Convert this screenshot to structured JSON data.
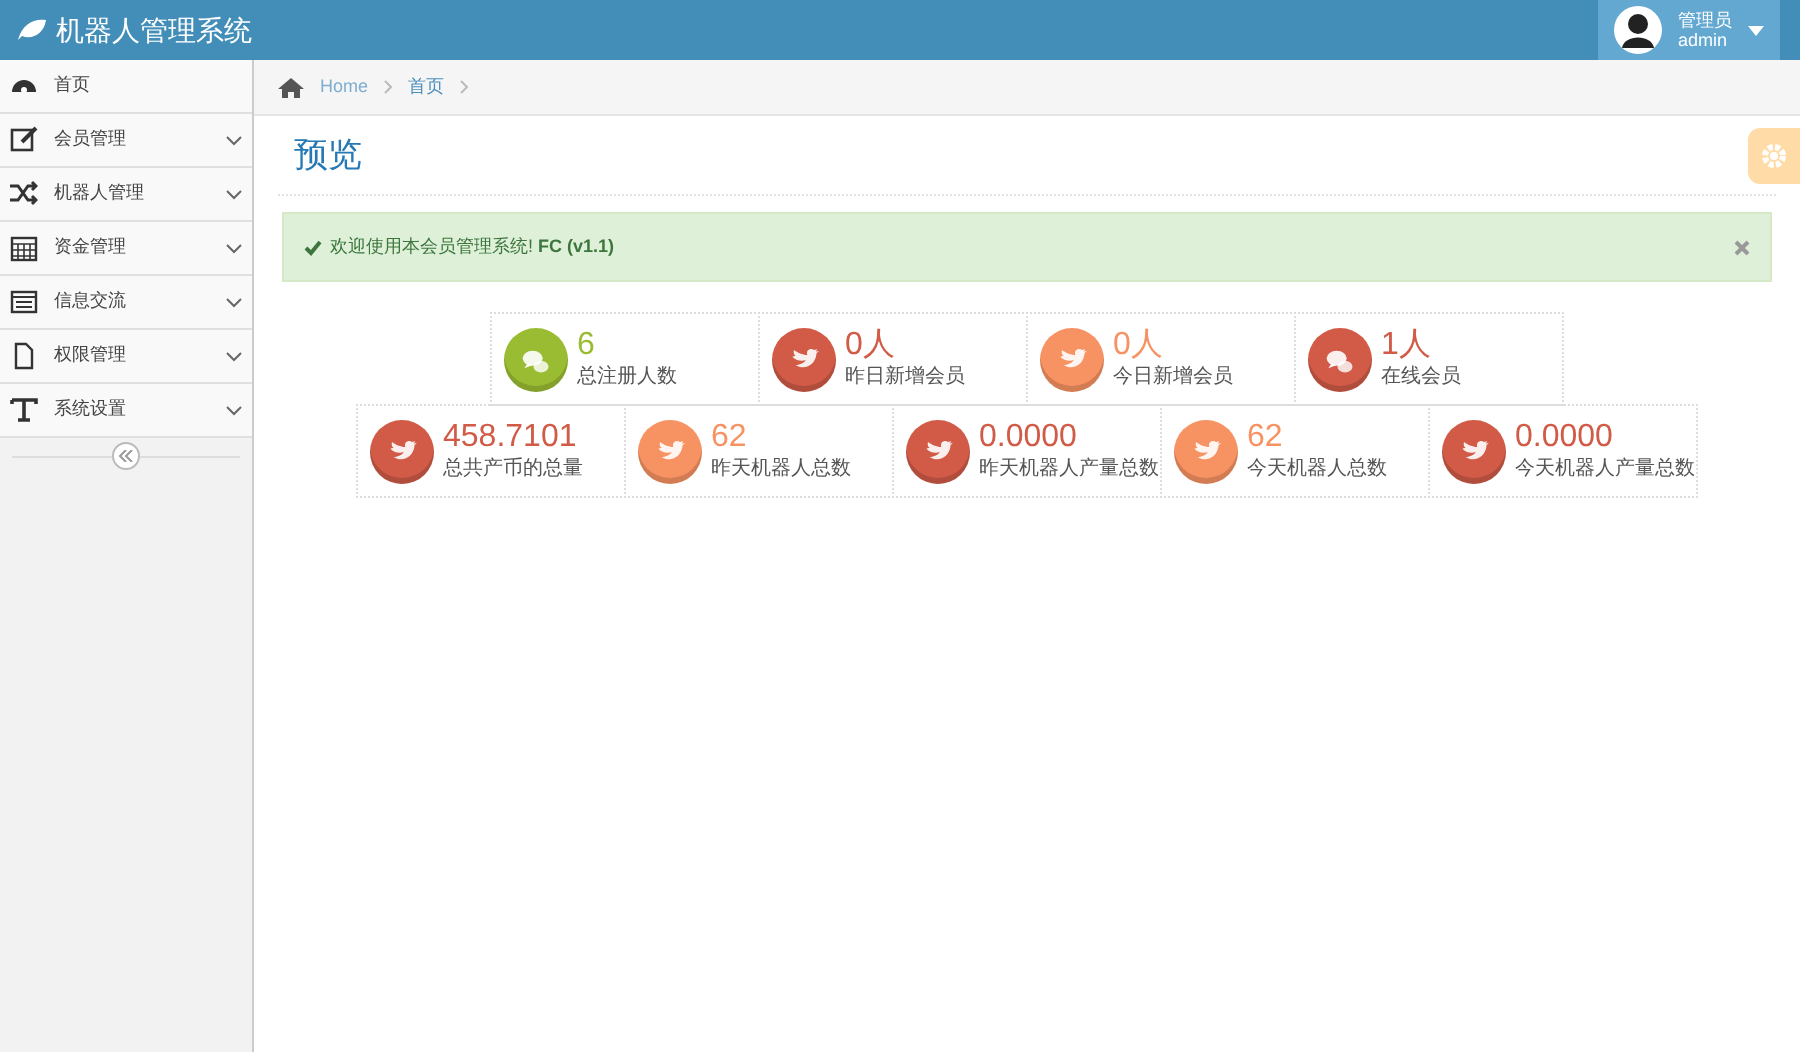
{
  "header": {
    "title": "机器人管理系统",
    "user": {
      "role": "管理员",
      "name": "admin"
    }
  },
  "sidebar": {
    "items": [
      {
        "label": "首页",
        "kind": "dashboard",
        "expandable": false
      },
      {
        "label": "会员管理",
        "kind": "edit",
        "expandable": true
      },
      {
        "label": "机器人管理",
        "kind": "shuffle",
        "expandable": true
      },
      {
        "label": "资金管理",
        "kind": "calendar",
        "expandable": true
      },
      {
        "label": "信息交流",
        "kind": "list",
        "expandable": true
      },
      {
        "label": "权限管理",
        "kind": "file",
        "expandable": true
      },
      {
        "label": "系统设置",
        "kind": "text",
        "expandable": true
      }
    ]
  },
  "breadcrumb": [
    "Home",
    "首页"
  ],
  "page_title": "预览",
  "alert": {
    "text": "欢迎使用本会员管理系统! **FC (v1.1)**"
  },
  "stat_rows": [
    [
      {
        "value": "6",
        "label": "总注册人数",
        "kind": "chat",
        "color": "#9abc32"
      },
      {
        "value": "0人",
        "label": "昨日新增会员",
        "kind": "bird",
        "color": "#d15b47"
      },
      {
        "value": "0人",
        "label": "今日新增会员",
        "kind": "bird",
        "color": "#f79263"
      },
      {
        "value": "1人",
        "label": "在线会员",
        "kind": "chat",
        "color": "#d15b47"
      }
    ],
    [
      {
        "value": "458.7101",
        "label": "总共产币的总量",
        "kind": "bird",
        "color": "#d15b47"
      },
      {
        "value": "62",
        "label": "昨天机器人总数",
        "kind": "bird",
        "color": "#f79263"
      },
      {
        "value": "0.0000",
        "label": "昨天机器人产量总数",
        "kind": "bird",
        "color": "#d15b47"
      },
      {
        "value": "62",
        "label": "今天机器人总数",
        "kind": "bird",
        "color": "#f79263"
      },
      {
        "value": "0.0000",
        "label": "今天机器人产量总数",
        "kind": "bird",
        "color": "#d15b47"
      }
    ]
  ]
}
